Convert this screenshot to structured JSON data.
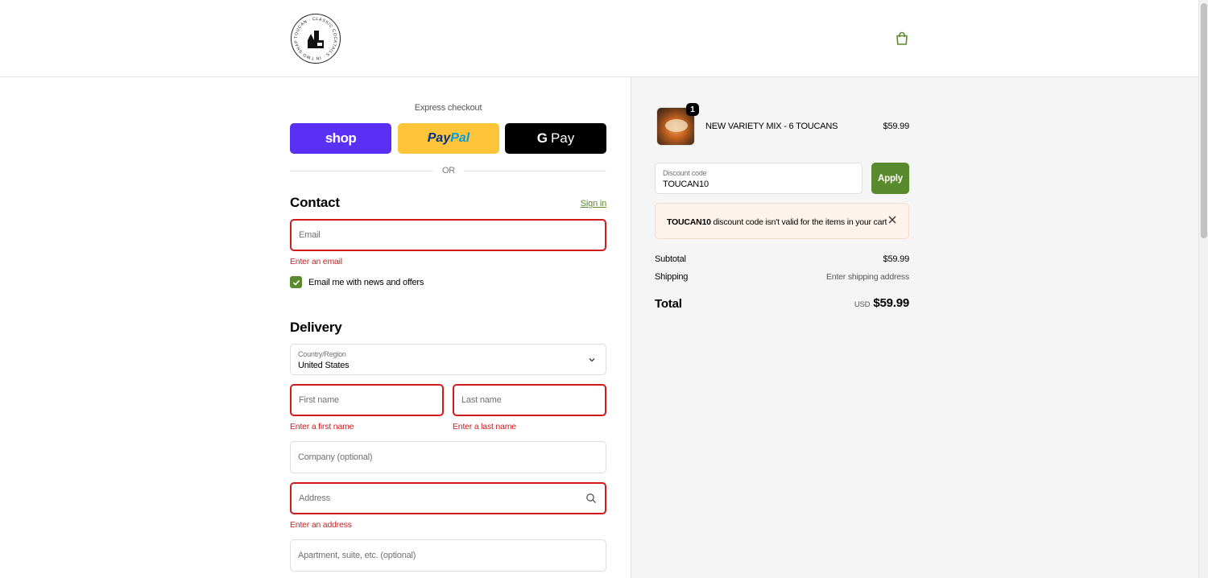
{
  "header": {
    "logo_text": [
      "TOUCAN",
      "CLASSIC COCKTAILS",
      "IN TWO SHAPES"
    ],
    "cart_icon": "shopping-bag-icon"
  },
  "express": {
    "label": "Express checkout",
    "shop_label": "shop",
    "paypal_label_1": "Pay",
    "paypal_label_2": "Pal",
    "gpay_g": "G",
    "gpay_label": "Pay",
    "or_label": "OR"
  },
  "contact": {
    "heading": "Contact",
    "sign_in": "Sign in",
    "email_placeholder": "Email",
    "email_error": "Enter an email",
    "newsletter_label": "Email me with news and offers",
    "newsletter_checked": true
  },
  "delivery": {
    "heading": "Delivery",
    "country_label": "Country/Region",
    "country_value": "United States",
    "first_name_placeholder": "First name",
    "first_name_error": "Enter a first name",
    "last_name_placeholder": "Last name",
    "last_name_error": "Enter a last name",
    "company_placeholder": "Company (optional)",
    "address_placeholder": "Address",
    "address_error": "Enter an address",
    "apartment_placeholder": "Apartment, suite, etc. (optional)"
  },
  "summary": {
    "item": {
      "quantity": "1",
      "name": "NEW VARIETY MIX - 6 TOUCANS",
      "price": "$59.99"
    },
    "discount": {
      "label": "Discount code",
      "value": "TOUCAN10",
      "apply_label": "Apply"
    },
    "notice": {
      "code": "TOUCAN10",
      "message": " discount code isn't valid for the items in your cart"
    },
    "subtotal_label": "Subtotal",
    "subtotal_value": "$59.99",
    "shipping_label": "Shipping",
    "shipping_value": "Enter shipping address",
    "total_label": "Total",
    "total_currency": "USD",
    "total_value": "$59.99"
  },
  "colors": {
    "accent": "#5a8a2e",
    "error": "#d11a1a",
    "shop": "#5a31f4",
    "paypal": "#ffc439"
  }
}
